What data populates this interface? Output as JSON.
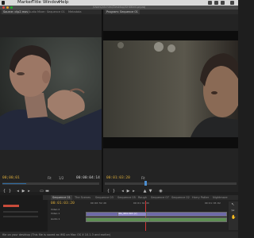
{
  "menubar": {
    "items": [
      "Marker",
      "Title",
      "Window",
      "Help"
    ]
  },
  "window_title": "/Users/ntchim/Desktop/Untitled.prproj",
  "tabs": [
    {
      "label": "Source: clip2.mov"
    },
    {
      "label": "Audio Mixer: Sequence 01"
    },
    {
      "label": "Metadata"
    },
    {
      "label": "Program: Sequence 01"
    }
  ],
  "source_monitor": {
    "timecode_in": "00;00;01",
    "fit": "Fit",
    "zoom": "1/2",
    "timecode_out": "00:00:04:14"
  },
  "program_monitor": {
    "timecode": "00:01:03:20",
    "fit": "Fit"
  },
  "timeline": {
    "tabs": [
      {
        "label": "Sequence 01"
      },
      {
        "label": "The Scenes"
      },
      {
        "label": "Sequence 03"
      },
      {
        "label": "Sequence 05"
      },
      {
        "label": "Rough"
      },
      {
        "label": "Sequence 07"
      },
      {
        "label": "Sequence 02"
      },
      {
        "label": "Harry Potter"
      },
      {
        "label": "Nightmare"
      }
    ],
    "timecode": "00:01:03:20",
    "ruler": [
      "00:00:59:28",
      "00:01:04:00",
      "00:01:05:02"
    ],
    "tracks": [
      {
        "name": "Video 2"
      },
      {
        "name": "Video 1"
      },
      {
        "name": "Audio 1"
      }
    ],
    "clip_label": "IMG_0801.MOV [V]"
  },
  "status_text": "file on your desktop (This file is saved as IMG on Mac OS X 10.1.3 and earlier)"
}
